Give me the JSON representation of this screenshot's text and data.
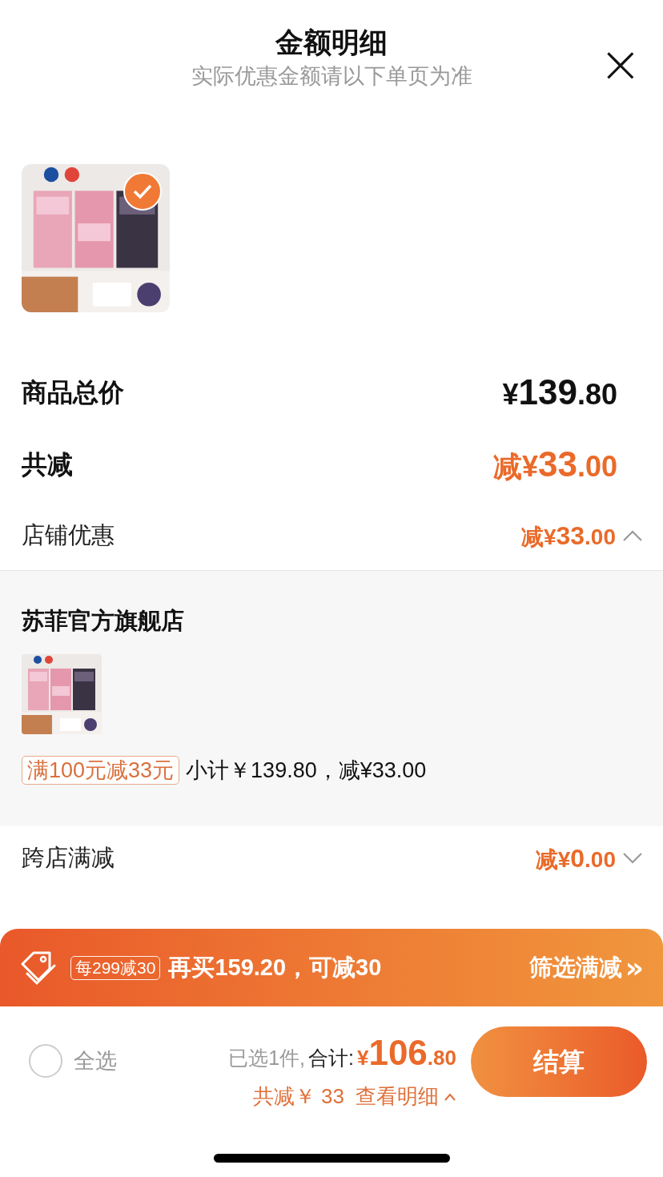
{
  "header": {
    "title": "金额明细",
    "subtitle": "实际优惠金额请以下单页为准",
    "close": "×"
  },
  "product": {
    "kind": "picture",
    "selected": true
  },
  "summary": [
    {
      "label": "商品总价",
      "value": "¥139.80",
      "kind": "total"
    },
    {
      "label": "共减",
      "value": "减¥33.00",
      "kind": "discount"
    }
  ],
  "sections": [
    {
      "label": "店铺优惠",
      "value": "减¥33.00",
      "expanded": true,
      "detail": {
        "store": "苏菲官方旗舰店",
        "coupon": "满100元减33元",
        "note": "小计￥139.80，减¥33.00"
      }
    },
    {
      "label": "跨店满减",
      "value": "减¥0.00",
      "expanded": false
    }
  ],
  "banner": {
    "tag": "每299减30",
    "text": "再买159.20，可减30",
    "action": "筛选满减",
    "action_icon": "»"
  },
  "footer": {
    "select_all": {
      "label": "全选",
      "checked": false
    },
    "count": "已选1件,",
    "total_label": "合计:",
    "total": "¥106.80",
    "saved": "共减￥ 33",
    "details": "查看明细",
    "checkout": "结算"
  }
}
